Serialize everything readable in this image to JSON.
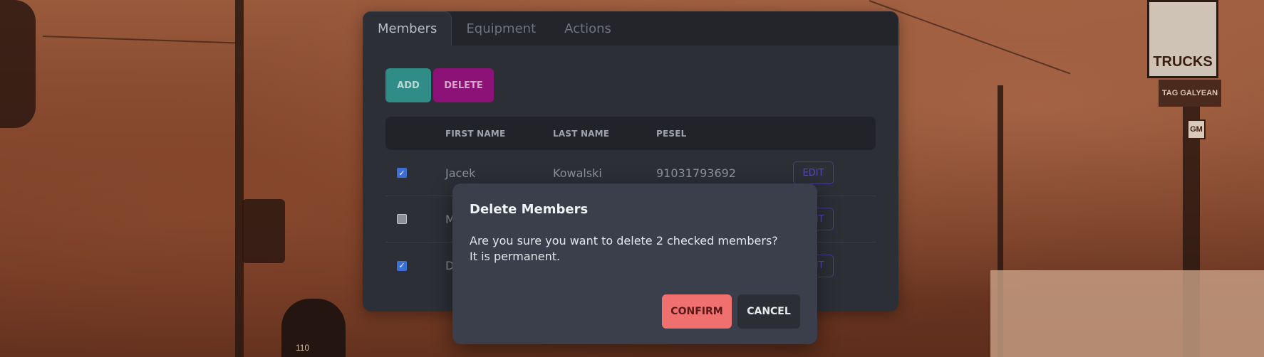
{
  "tabs": [
    {
      "label": "Members",
      "active": true
    },
    {
      "label": "Equipment",
      "active": false
    },
    {
      "label": "Actions",
      "active": false
    }
  ],
  "toolbar": {
    "add_label": "ADD",
    "delete_label": "DELETE"
  },
  "table": {
    "headers": [
      "FIRST NAME",
      "LAST NAME",
      "PESEL"
    ],
    "rows": [
      {
        "checked": true,
        "first": "Jacek",
        "last": "Kowalski",
        "pesel": "91031793692",
        "edit": "EDIT"
      },
      {
        "checked": false,
        "first": "M",
        "last": "",
        "pesel": "",
        "edit": "EDIT"
      },
      {
        "checked": true,
        "first": "D",
        "last": "",
        "pesel": "",
        "edit": "EDIT"
      }
    ]
  },
  "modal": {
    "title": "Delete Members",
    "line1": "Are you sure you want to delete 2 checked members?",
    "line2": "It is permanent.",
    "confirm_label": "CONFIRM",
    "cancel_label": "CANCEL"
  },
  "background": {
    "sign_text": "TRUCKS",
    "sign_subtext": "TAG GALYEAN",
    "sign_badge": "GM",
    "firefighter_badge": "110"
  },
  "colors": {
    "accent_add": "#2f8c86",
    "accent_delete": "#8d1278",
    "confirm": "#f07070",
    "checkbox": "#3b6fd6"
  }
}
